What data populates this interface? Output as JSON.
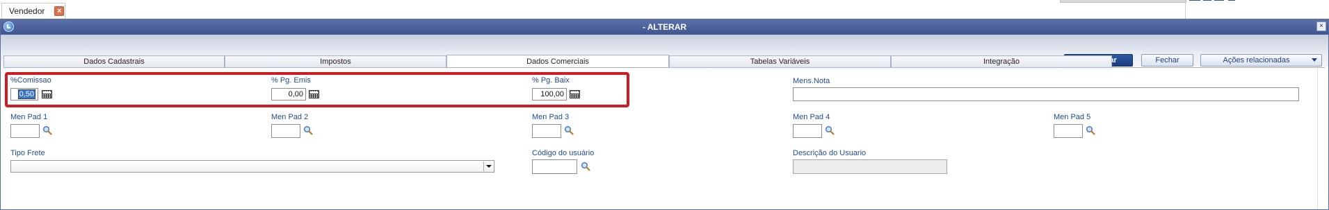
{
  "doc_tab": {
    "label": "Vendedor",
    "close_glyph": "×"
  },
  "window": {
    "title": "- ALTERAR",
    "close_glyph": "×"
  },
  "toolbar": {
    "confirm_label": "Confirmar",
    "close_label": "Fechar",
    "actions_label": "Ações relacionadas"
  },
  "tabs": [
    {
      "label": "Dados Cadastrais"
    },
    {
      "label": "Impostos"
    },
    {
      "label": "Dados Comerciais"
    },
    {
      "label": "Tabelas Variáveis"
    },
    {
      "label": "Integração"
    }
  ],
  "active_tab": "Dados Comerciais",
  "form": {
    "comissao": {
      "label": "%Comissao",
      "value": "0,50"
    },
    "pg_emis": {
      "label": "% Pg. Emis",
      "value": "0,00"
    },
    "pg_baix": {
      "label": "% Pg. Baix",
      "value": "100,00"
    },
    "mens_nota": {
      "label": "Mens.Nota",
      "value": ""
    },
    "men_pad_1": {
      "label": "Men Pad 1",
      "value": ""
    },
    "men_pad_2": {
      "label": "Men Pad 2",
      "value": ""
    },
    "men_pad_3": {
      "label": "Men Pad 3",
      "value": ""
    },
    "men_pad_4": {
      "label": "Men Pad 4",
      "value": ""
    },
    "men_pad_5": {
      "label": "Men Pad 5",
      "value": ""
    },
    "tipo_frete": {
      "label": "Tipo Frete",
      "value": ""
    },
    "codigo_usuario": {
      "label": "Código do usuário",
      "value": ""
    },
    "descricao_usuario": {
      "label": "Descrição do Usuario",
      "value": ""
    }
  },
  "icons": {
    "calculator": "calculator-icon",
    "lookup": "magnifier-icon",
    "dropdown": "chevron-down-icon",
    "window_system": "window-system-icon"
  },
  "colors": {
    "titlebar": "#4a5f9c",
    "primary_button": "#1f4a8f",
    "field_label": "#1f4b8c",
    "highlight": "#d21a22",
    "doc_close": "#d9734f"
  }
}
